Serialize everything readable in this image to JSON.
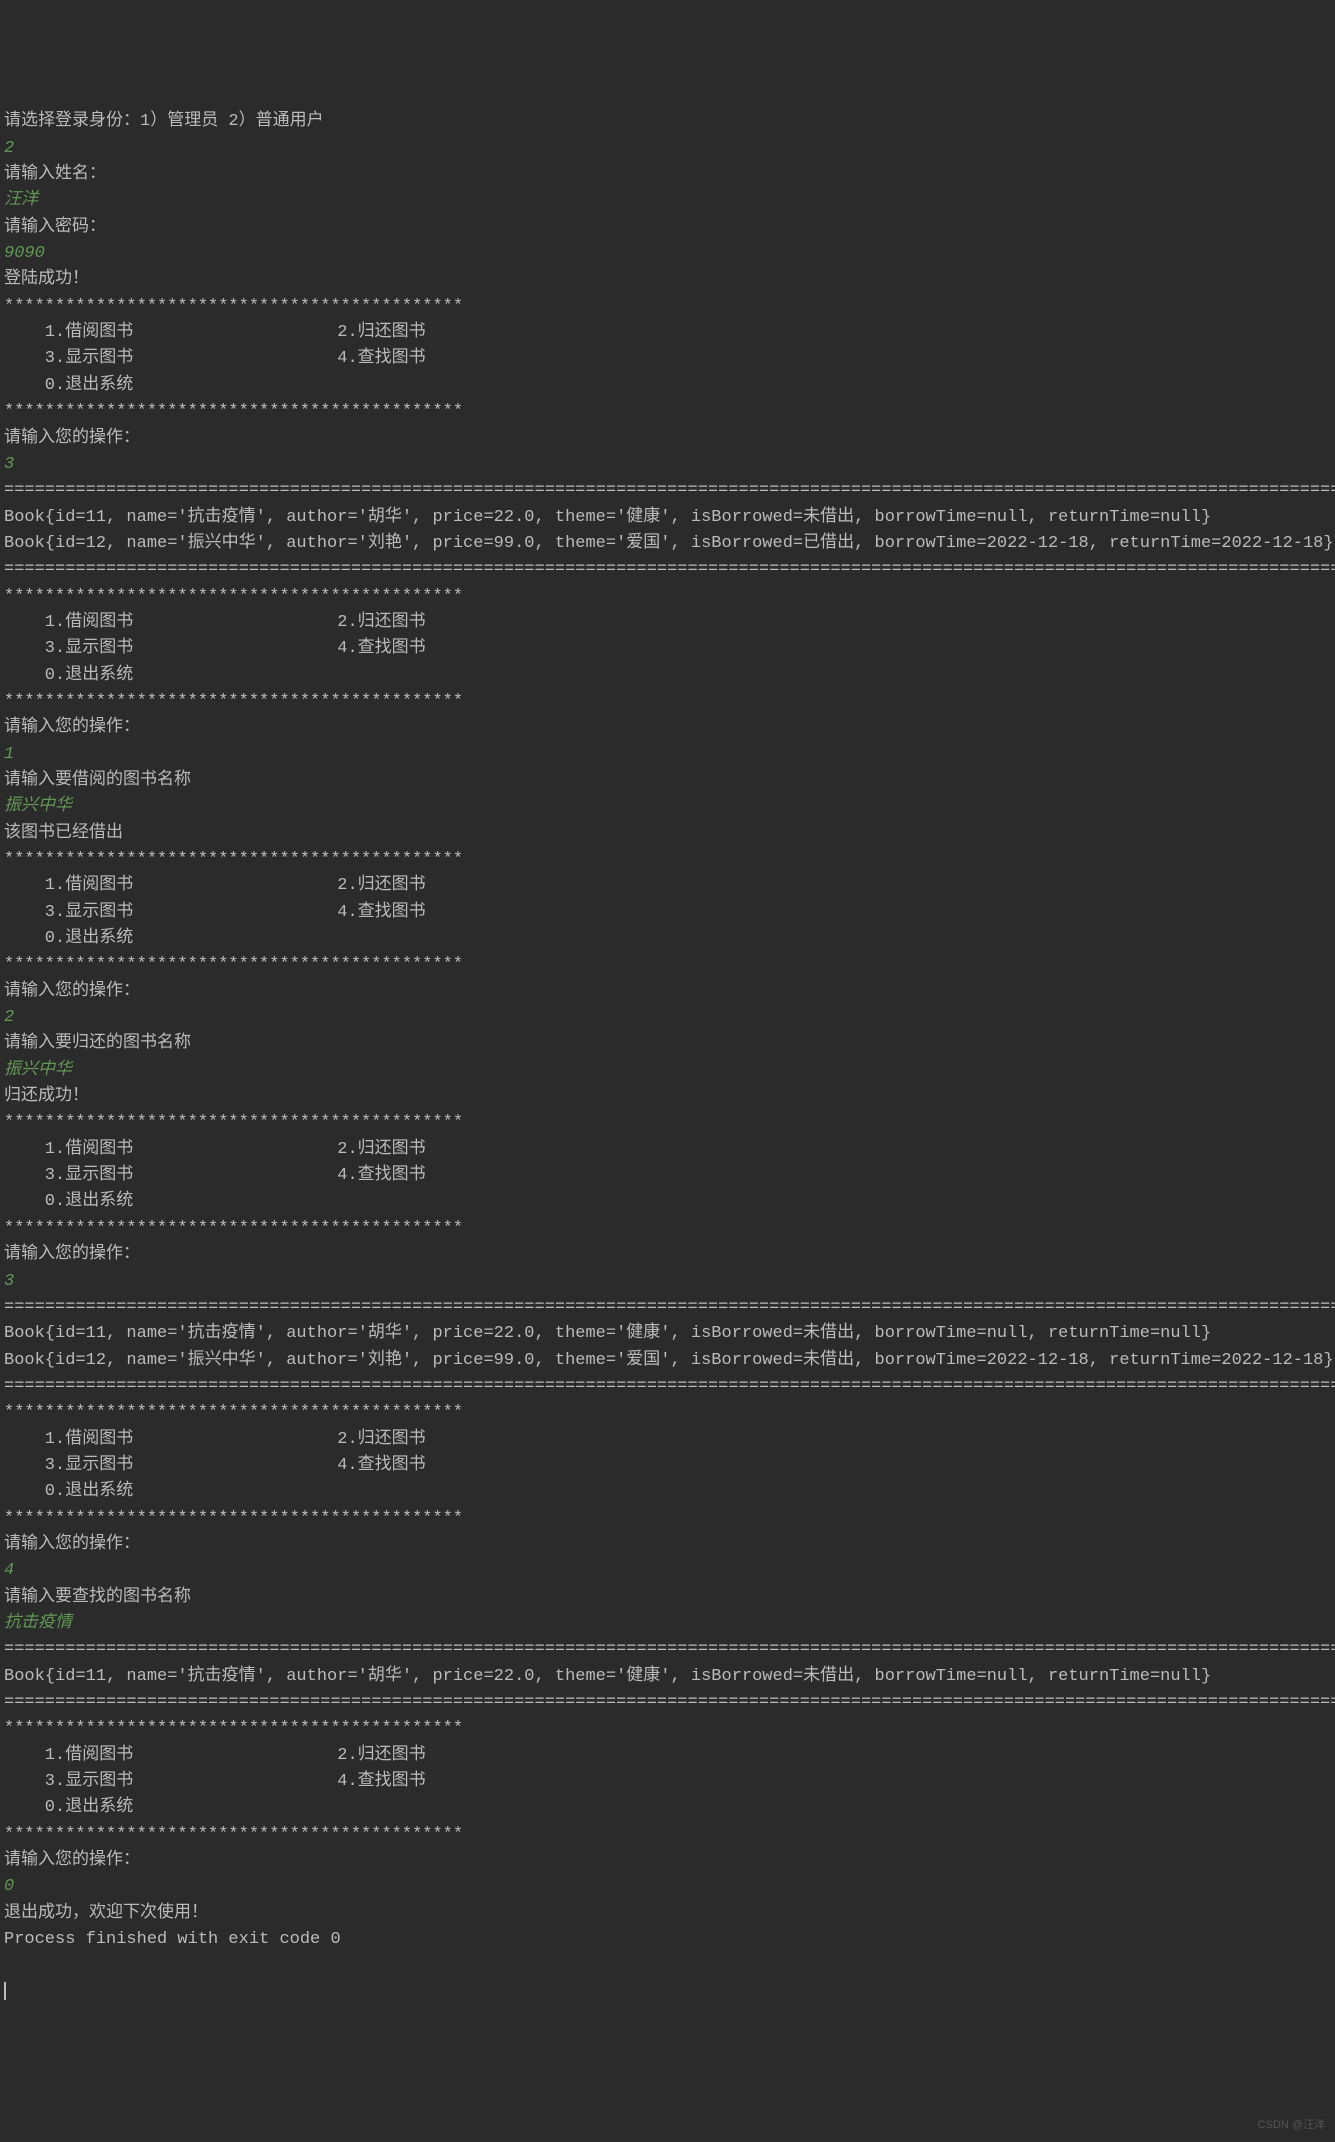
{
  "lines": [
    {
      "type": "output",
      "text": "请选择登录身份：1）管理员 2）普通用户"
    },
    {
      "type": "input",
      "text": "2"
    },
    {
      "type": "output",
      "text": "请输入姓名："
    },
    {
      "type": "input",
      "text": "汪洋"
    },
    {
      "type": "output",
      "text": "请输入密码："
    },
    {
      "type": "input",
      "text": "9090"
    },
    {
      "type": "output",
      "text": "登陆成功！"
    },
    {
      "type": "output",
      "text": "*********************************************"
    },
    {
      "type": "output",
      "text": "    1.借阅图书                    2.归还图书"
    },
    {
      "type": "output",
      "text": "    3.显示图书                    4.查找图书"
    },
    {
      "type": "output",
      "text": "    0.退出系统"
    },
    {
      "type": "output",
      "text": "*********************************************"
    },
    {
      "type": "output",
      "text": "请输入您的操作："
    },
    {
      "type": "input",
      "text": "3"
    },
    {
      "type": "output",
      "text": ""
    },
    {
      "type": "output",
      "text": "====================================================================================================================================================="
    },
    {
      "type": "output",
      "text": "Book{id=11, name='抗击疫情', author='胡华', price=22.0, theme='健康', isBorrowed=未借出, borrowTime=null, returnTime=null}"
    },
    {
      "type": "output",
      "text": "Book{id=12, name='振兴中华', author='刘艳', price=99.0, theme='爱国', isBorrowed=已借出, borrowTime=2022-12-18, returnTime=2022-12-18}"
    },
    {
      "type": "output",
      "text": "====================================================================================================================================================="
    },
    {
      "type": "output",
      "text": "*********************************************"
    },
    {
      "type": "output",
      "text": "    1.借阅图书                    2.归还图书"
    },
    {
      "type": "output",
      "text": "    3.显示图书                    4.查找图书"
    },
    {
      "type": "output",
      "text": "    0.退出系统"
    },
    {
      "type": "output",
      "text": "*********************************************"
    },
    {
      "type": "output",
      "text": "请输入您的操作："
    },
    {
      "type": "input",
      "text": "1"
    },
    {
      "type": "output",
      "text": "请输入要借阅的图书名称"
    },
    {
      "type": "input",
      "text": "振兴中华"
    },
    {
      "type": "output",
      "text": "该图书已经借出"
    },
    {
      "type": "output",
      "text": "*********************************************"
    },
    {
      "type": "output",
      "text": "    1.借阅图书                    2.归还图书"
    },
    {
      "type": "output",
      "text": "    3.显示图书                    4.查找图书"
    },
    {
      "type": "output",
      "text": "    0.退出系统"
    },
    {
      "type": "output",
      "text": "*********************************************"
    },
    {
      "type": "output",
      "text": "请输入您的操作："
    },
    {
      "type": "input",
      "text": "2"
    },
    {
      "type": "output",
      "text": "请输入要归还的图书名称"
    },
    {
      "type": "input",
      "text": "振兴中华"
    },
    {
      "type": "output",
      "text": "归还成功！"
    },
    {
      "type": "output",
      "text": "*********************************************"
    },
    {
      "type": "output",
      "text": "    1.借阅图书                    2.归还图书"
    },
    {
      "type": "output",
      "text": "    3.显示图书                    4.查找图书"
    },
    {
      "type": "output",
      "text": "    0.退出系统"
    },
    {
      "type": "output",
      "text": "*********************************************"
    },
    {
      "type": "output",
      "text": "请输入您的操作："
    },
    {
      "type": "input",
      "text": "3"
    },
    {
      "type": "output",
      "text": ""
    },
    {
      "type": "output",
      "text": "====================================================================================================================================================="
    },
    {
      "type": "output",
      "text": "Book{id=11, name='抗击疫情', author='胡华', price=22.0, theme='健康', isBorrowed=未借出, borrowTime=null, returnTime=null}"
    },
    {
      "type": "output",
      "text": "Book{id=12, name='振兴中华', author='刘艳', price=99.0, theme='爱国', isBorrowed=未借出, borrowTime=2022-12-18, returnTime=2022-12-18}"
    },
    {
      "type": "output",
      "text": "====================================================================================================================================================="
    },
    {
      "type": "output",
      "text": "*********************************************"
    },
    {
      "type": "output",
      "text": "    1.借阅图书                    2.归还图书"
    },
    {
      "type": "output",
      "text": "    3.显示图书                    4.查找图书"
    },
    {
      "type": "output",
      "text": "    0.退出系统"
    },
    {
      "type": "output",
      "text": "*********************************************"
    },
    {
      "type": "output",
      "text": "请输入您的操作："
    },
    {
      "type": "input",
      "text": "4"
    },
    {
      "type": "output",
      "text": "请输入要查找的图书名称"
    },
    {
      "type": "input",
      "text": "抗击疫情"
    },
    {
      "type": "output",
      "text": ""
    },
    {
      "type": "output",
      "text": "====================================================================================================================================================="
    },
    {
      "type": "output",
      "text": "Book{id=11, name='抗击疫情', author='胡华', price=22.0, theme='健康', isBorrowed=未借出, borrowTime=null, returnTime=null}"
    },
    {
      "type": "output",
      "text": "====================================================================================================================================================="
    },
    {
      "type": "output",
      "text": "*********************************************"
    },
    {
      "type": "output",
      "text": "    1.借阅图书                    2.归还图书"
    },
    {
      "type": "output",
      "text": "    3.显示图书                    4.查找图书"
    },
    {
      "type": "output",
      "text": "    0.退出系统"
    },
    {
      "type": "output",
      "text": "*********************************************"
    },
    {
      "type": "output",
      "text": "请输入您的操作："
    },
    {
      "type": "input",
      "text": "0"
    },
    {
      "type": "output",
      "text": "退出成功，欢迎下次使用！"
    },
    {
      "type": "output",
      "text": ""
    },
    {
      "type": "output",
      "text": "Process finished with exit code 0"
    }
  ],
  "watermark": "CSDN @汪洋"
}
